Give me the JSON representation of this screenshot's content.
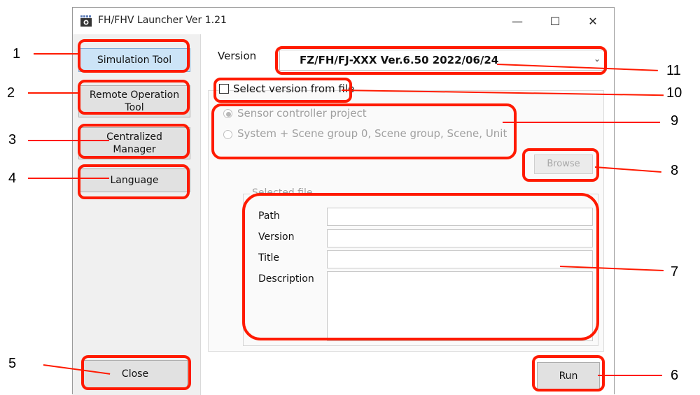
{
  "window": {
    "title": "FH/FHV Launcher Ver 1.21",
    "minimize": "—",
    "maximize": "☐",
    "close": "✕"
  },
  "sidebar": {
    "simulation_tool": "Simulation Tool",
    "remote_operation_tool": "Remote Operation Tool",
    "centralized_manager": "Centralized Manager",
    "language": "Language",
    "close": "Close"
  },
  "main": {
    "version_label": "Version",
    "version_value": "FZ/FH/FJ-XXX Ver.6.50 2022/06/24",
    "select_from_file": "Select version from file",
    "radio_sensor_project": "Sensor controller project",
    "radio_system_scene": "System + Scene group 0, Scene group, Scene, Unit",
    "browse": "Browse",
    "selected_file_legend": "Selected file",
    "path_label": "Path",
    "version_field_label": "Version",
    "title_label": "Title",
    "description_label": "Description",
    "run": "Run"
  },
  "callouts": [
    "1",
    "2",
    "3",
    "4",
    "5",
    "6",
    "7",
    "8",
    "9",
    "10",
    "11"
  ],
  "colors": {
    "highlight": "#ff1a00",
    "active_button": "#cce4f7"
  }
}
